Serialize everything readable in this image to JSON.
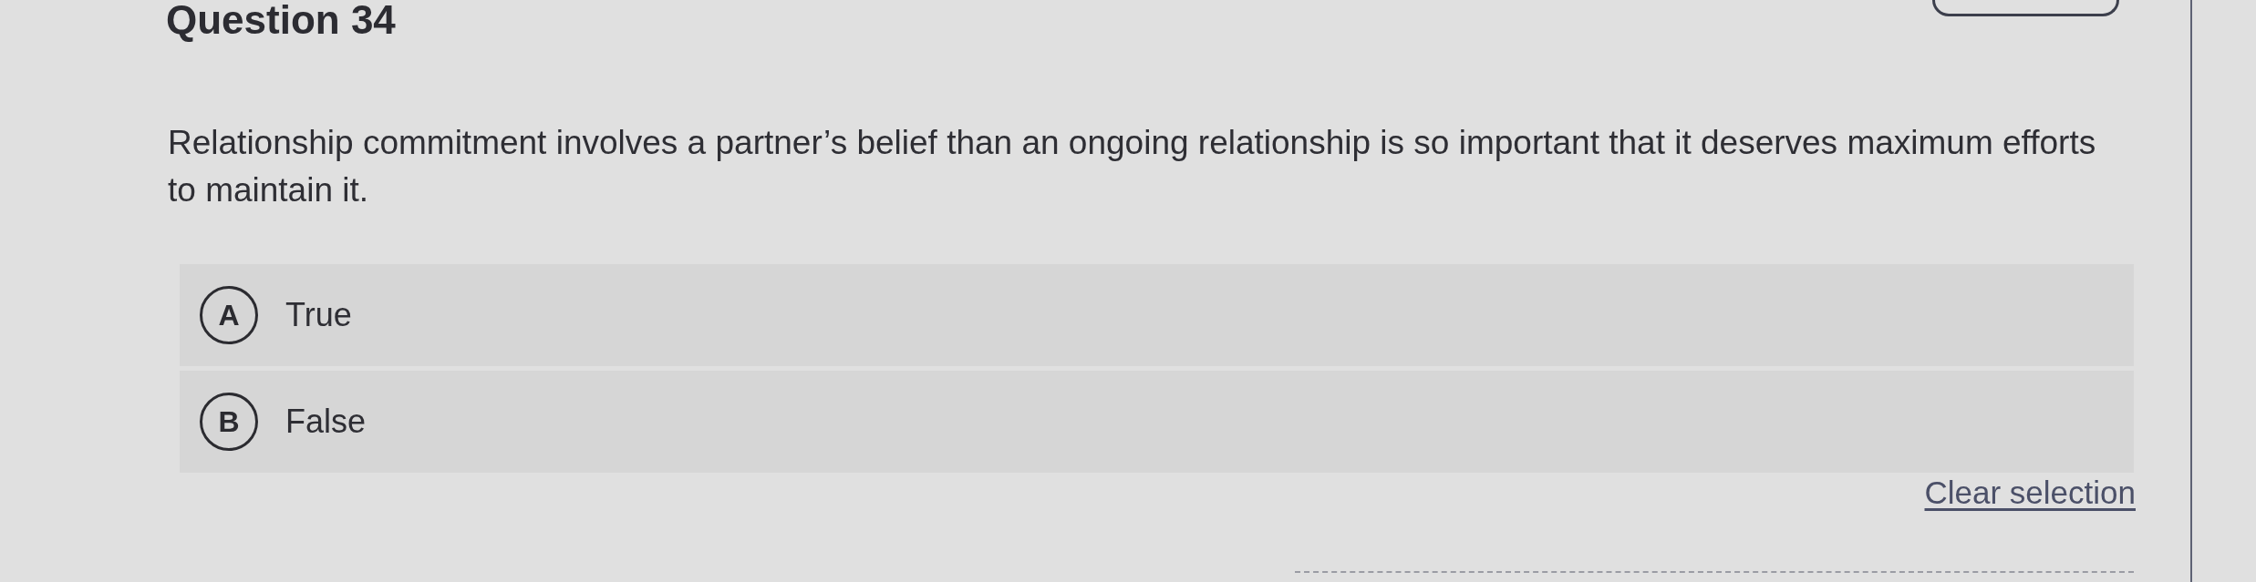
{
  "question": {
    "title": "Question 34",
    "text": "Relationship commitment involves a partner’s belief than an ongoing relationship is so important that it deserves maximum efforts to maintain it."
  },
  "options": [
    {
      "letter": "A",
      "label": "True",
      "selected": false
    },
    {
      "letter": "B",
      "label": "False",
      "selected": false
    }
  ],
  "clear_selection": "Clear selection"
}
